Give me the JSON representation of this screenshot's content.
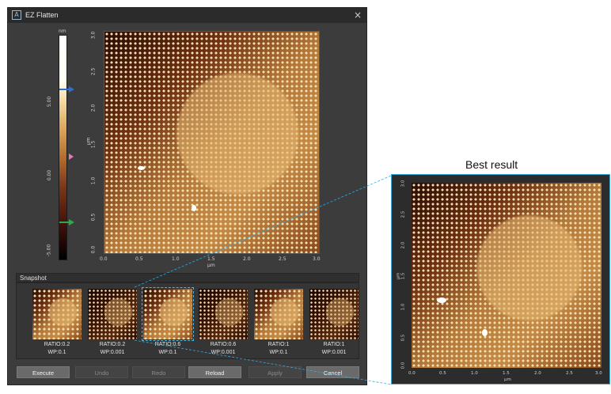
{
  "window": {
    "title": "EZ Flatten",
    "icon": "app-logo-icon",
    "close_glyph": "×"
  },
  "color_scale": {
    "unit": "nm",
    "ticks": [
      "5.00",
      "0.00",
      "-5.00"
    ],
    "markers": [
      {
        "name": "upper-limit-marker",
        "color": "#2e6fd0"
      },
      {
        "name": "midpoint-marker",
        "color": "#e07ab8"
      },
      {
        "name": "lower-limit-marker",
        "color": "#2bab4a"
      }
    ]
  },
  "main_image": {
    "x_ticks": [
      "0.0",
      "0.5",
      "1.0",
      "1.5",
      "2.0",
      "2.5",
      "3.0"
    ],
    "y_ticks": [
      "3.0",
      "2.5",
      "2.0",
      "1.5",
      "1.0",
      "0.5",
      "0.0"
    ],
    "x_label": "μm",
    "y_label": "μm"
  },
  "snapshot": {
    "header": "Snapshot",
    "items": [
      {
        "ratio": "RATIO:0.2",
        "wp": "WP:0.1",
        "style": "bright"
      },
      {
        "ratio": "RATIO:0.2",
        "wp": "WP:0.001",
        "style": "dark"
      },
      {
        "ratio": "RATIO:0.6",
        "wp": "WP:0.1",
        "style": "bright",
        "selected": true
      },
      {
        "ratio": "RATIO:0.6",
        "wp": "WP:0.001",
        "style": "dark"
      },
      {
        "ratio": "RATIO:1",
        "wp": "WP:0.1",
        "style": "bright"
      },
      {
        "ratio": "RATIO:1",
        "wp": "WP:0.001",
        "style": "dark"
      }
    ]
  },
  "buttons": [
    {
      "label": "Execute",
      "name": "execute-button",
      "enabled": true
    },
    {
      "label": "Undo",
      "name": "undo-button",
      "enabled": false
    },
    {
      "label": "Redo",
      "name": "redo-button",
      "enabled": false
    },
    {
      "label": "Reload",
      "name": "reload-button",
      "enabled": true
    },
    {
      "label": "Apply",
      "name": "apply-button",
      "enabled": false
    },
    {
      "label": "Cancel",
      "name": "cancel-button",
      "enabled": true
    }
  ],
  "best_result": {
    "title": "Best result",
    "x_ticks": [
      "0.0",
      "0.5",
      "1.0",
      "1.5",
      "2.0",
      "2.5",
      "3.0"
    ],
    "y_ticks": [
      "3.0",
      "2.5",
      "2.0",
      "1.5",
      "1.0",
      "0.5",
      "0.0"
    ],
    "x_label": "μm",
    "y_label": "μm"
  },
  "colors": {
    "accent_highlight": "#3aa8d8",
    "window_bg": "#3c3c3c"
  }
}
